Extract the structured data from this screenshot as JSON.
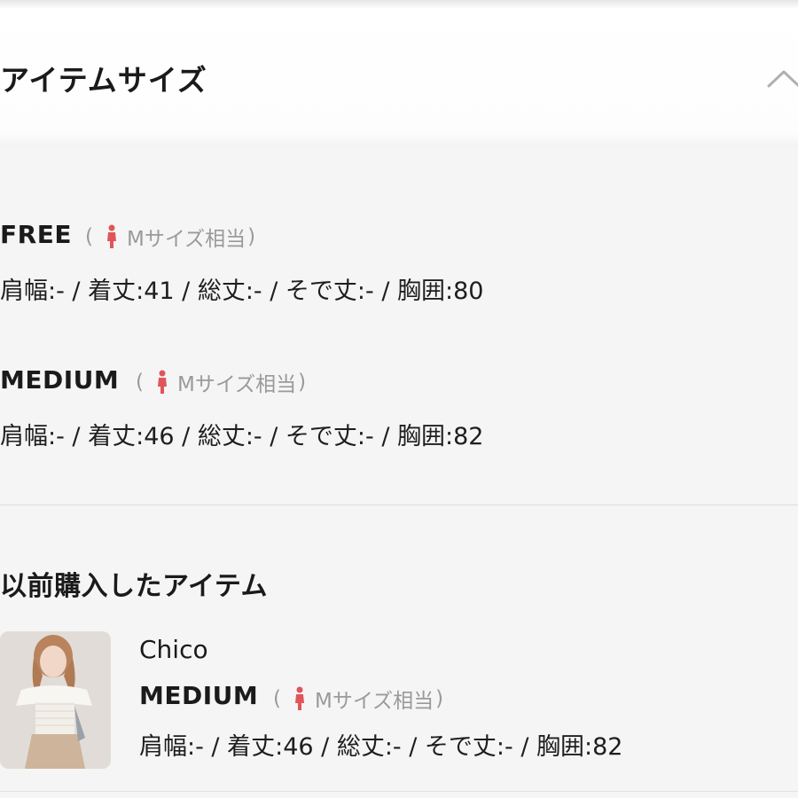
{
  "item_size": {
    "title": "アイテムサイズ",
    "collapse_icon": "chevron-up-icon",
    "sizes": [
      {
        "label": "FREE",
        "equivalent": "Mサイズ相当",
        "icon": "person-icon",
        "measurements": "肩幅:- / 着丈:41 / 総丈:- / そで丈:- / 胸囲:80"
      },
      {
        "label": "MEDIUM",
        "equivalent": "Mサイズ相当",
        "icon": "person-icon",
        "measurements": "肩幅:- / 着丈:46 / 総丈:- / そで丈:- / 胸囲:82"
      }
    ]
  },
  "purchase_history": {
    "title": "以前購入したアイテム",
    "items": [
      {
        "thumbnail": "product-photo",
        "brand": "Chico",
        "size_label": "MEDIUM",
        "equivalent": "Mサイズ相当",
        "icon": "person-icon",
        "measurements": "肩幅:- / 着丈:46 / 総丈:- / そで丈:- / 胸囲:82"
      }
    ]
  },
  "colors": {
    "person_icon": "#e0555a",
    "muted_text": "#9a9a9a",
    "divider": "#dddddd"
  }
}
